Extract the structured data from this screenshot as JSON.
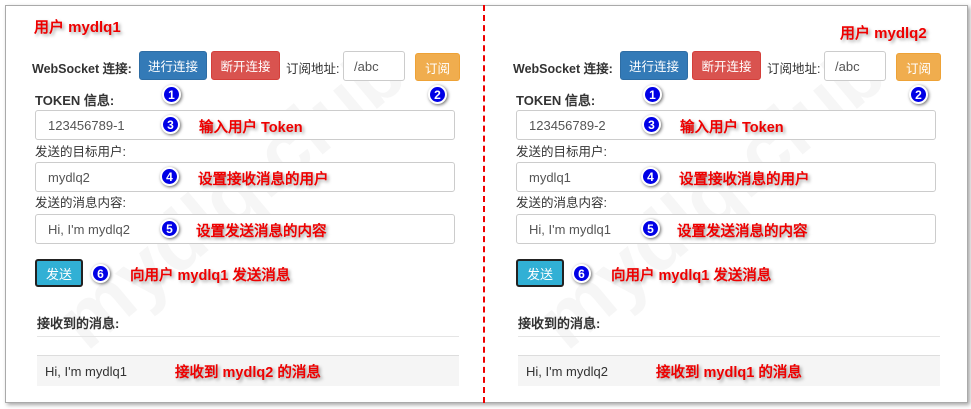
{
  "watermark": "mydlq.club",
  "panels": [
    {
      "title": "用户 mydlq1",
      "ws_label": "WebSocket 连接:",
      "connect": "进行连接",
      "disconnect": "断开连接",
      "sub_label": "订阅地址:",
      "sub_value": "/abc",
      "subscribe": "订阅",
      "token_label": "TOKEN 信息:",
      "token_value": "123456789-1",
      "target_label": "发送的目标用户:",
      "target_value": "mydlq2",
      "content_label": "发送的消息内容:",
      "content_value": "Hi, I'm mydlq2",
      "send": "发送",
      "received_label": "接收到的消息:",
      "received_message": "Hi, I'm mydlq1",
      "notes": {
        "token": "输入用户 Token",
        "target": "设置接收消息的用户",
        "content": "设置发送消息的内容",
        "send": "向用户 mydlq1 发送消息",
        "received": "接收到 mydlq2 的消息"
      }
    },
    {
      "title": "用户 mydlq2",
      "ws_label": "WebSocket 连接:",
      "connect": "进行连接",
      "disconnect": "断开连接",
      "sub_label": "订阅地址:",
      "sub_value": "/abc",
      "subscribe": "订阅",
      "token_label": "TOKEN 信息:",
      "token_value": "123456789-2",
      "target_label": "发送的目标用户:",
      "target_value": "mydlq1",
      "content_label": "发送的消息内容:",
      "content_value": "Hi, I'm mydlq1",
      "send": "发送",
      "received_label": "接收到的消息:",
      "received_message": "Hi, I'm mydlq2",
      "notes": {
        "token": "输入用户 Token",
        "target": "设置接收消息的用户",
        "content": "设置发送消息的内容",
        "send": "向用户 mydlq1 发送消息",
        "received": "接收到 mydlq1 的消息"
      }
    }
  ],
  "markers": [
    "1",
    "2",
    "3",
    "4",
    "5",
    "6"
  ],
  "colors": {
    "primary": "#337ab7",
    "danger": "#d9534f",
    "warning": "#f0ad4e",
    "info": "#31b0d5",
    "annotation": "#ee0000",
    "marker": "#0000e6"
  }
}
